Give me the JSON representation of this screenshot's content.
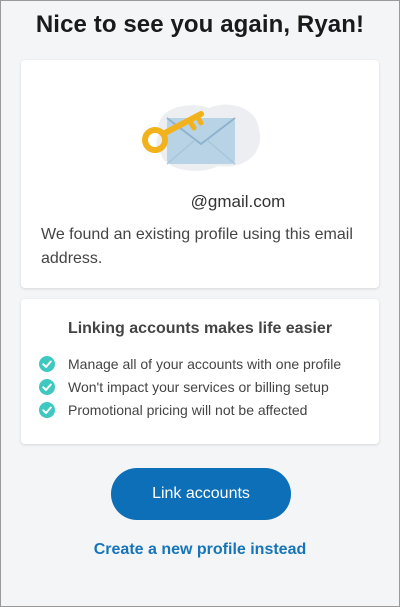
{
  "header": {
    "title": "Nice to see you again, Ryan!"
  },
  "profile_card": {
    "illustration_icon": "key-and-envelope-icon",
    "email_visible": "@gmail.com",
    "message": "We found an existing profile using this email address."
  },
  "benefits_card": {
    "heading": "Linking accounts makes life easier",
    "check_icon": "check-circle-icon",
    "items": [
      {
        "label": "Manage all of your accounts with one profile"
      },
      {
        "label": "Won't impact your services or billing setup"
      },
      {
        "label": "Promotional pricing will not be affected"
      }
    ]
  },
  "actions": {
    "primary_label": "Link accounts",
    "secondary_label": "Create a new profile instead"
  },
  "colors": {
    "primary": "#0d6fb8",
    "link": "#1675b8",
    "check": "#3ec8c0",
    "key": "#f2b21c"
  }
}
